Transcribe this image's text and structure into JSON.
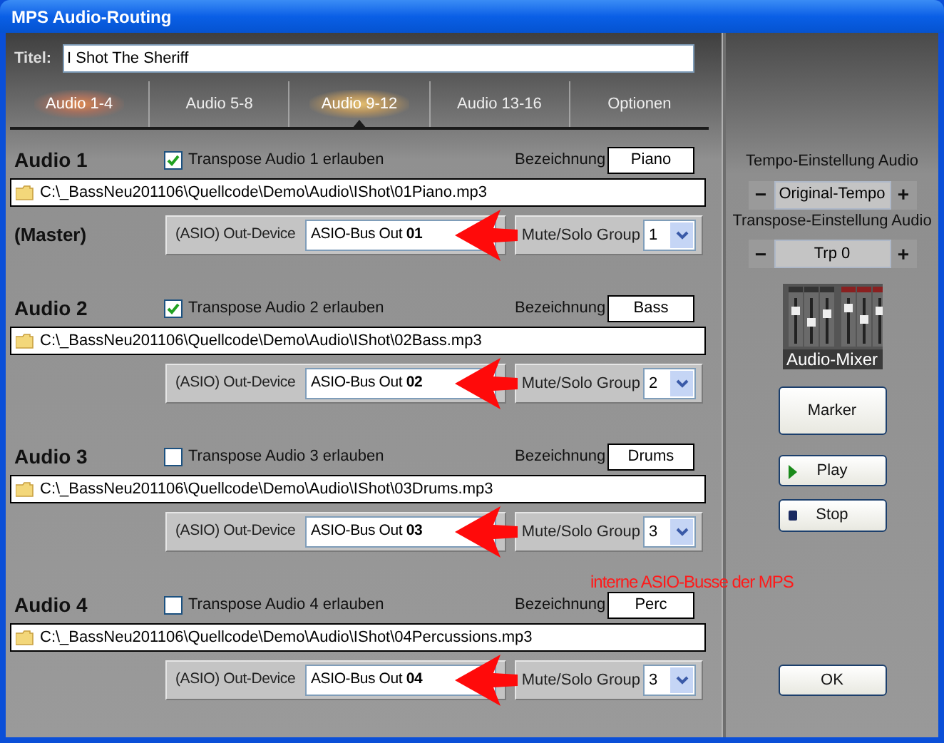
{
  "window": {
    "title": "MPS Audio-Routing"
  },
  "title_field": {
    "label": "Titel:",
    "value": "I Shot The Sheriff"
  },
  "tabs": [
    {
      "label": "Audio 1-4",
      "selected": false,
      "glow": true
    },
    {
      "label": "Audio 5-8",
      "selected": false,
      "glow": false
    },
    {
      "label": "Audio 9-12",
      "selected": true,
      "glow": true
    },
    {
      "label": "Audio 13-16",
      "selected": false,
      "glow": false
    },
    {
      "label": "Optionen",
      "selected": false,
      "glow": false
    }
  ],
  "channels": [
    {
      "name": "Audio 1",
      "role": "(Master)",
      "transpose_label": "Transpose Audio 1 erlauben",
      "transpose_allowed": true,
      "designation_label": "Bezeichnung",
      "designation": "Piano",
      "path": "C:\\_BassNeu201106\\Quellcode\\Demo\\Audio\\IShot\\01Piano.mp3",
      "device_label": "(ASIO) Out-Device",
      "device": "ASIO-Bus Out **01**",
      "group_label": "Mute/Solo Group",
      "group": "1"
    },
    {
      "name": "Audio 2",
      "transpose_label": "Transpose Audio 2 erlauben",
      "transpose_allowed": true,
      "designation_label": "Bezeichnung",
      "designation": "Bass",
      "path": "C:\\_BassNeu201106\\Quellcode\\Demo\\Audio\\IShot\\02Bass.mp3",
      "device_label": "(ASIO) Out-Device",
      "device": "ASIO-Bus Out **02**",
      "group_label": "Mute/Solo Group",
      "group": "2"
    },
    {
      "name": "Audio 3",
      "transpose_label": "Transpose Audio 3 erlauben",
      "transpose_allowed": false,
      "designation_label": "Bezeichnung",
      "designation": "Drums",
      "path": "C:\\_BassNeu201106\\Quellcode\\Demo\\Audio\\IShot\\03Drums.mp3",
      "device_label": "(ASIO) Out-Device",
      "device": "ASIO-Bus Out **03**",
      "group_label": "Mute/Solo Group",
      "group": "3"
    },
    {
      "name": "Audio 4",
      "transpose_label": "Transpose Audio 4 erlauben",
      "transpose_allowed": false,
      "designation_label": "Bezeichnung",
      "designation": "Perc",
      "path": "C:\\_BassNeu201106\\Quellcode\\Demo\\Audio\\IShot\\04Percussions.mp3",
      "device_label": "(ASIO) Out-Device",
      "device": "ASIO-Bus Out **04**",
      "group_label": "Mute/Solo Group",
      "group": "3"
    }
  ],
  "annotation": "interne ASIO-Busse der MPS",
  "steppers": [
    {
      "label": "Tempo-Einstellung Audio",
      "minus": "−",
      "value": "Original-Tempo",
      "plus": "+"
    },
    {
      "label": "Transpose-Einstellung Audio",
      "minus": "−",
      "value": "Trp 0",
      "plus": "+"
    }
  ],
  "mixer": {
    "label": "Audio-Mixer"
  },
  "buttons": [
    {
      "kind": "marker",
      "label": "Marker"
    },
    {
      "kind": "play",
      "label": "Play"
    },
    {
      "kind": "stop",
      "label": "Stop"
    },
    {
      "kind": "ok",
      "label": "OK"
    }
  ]
}
